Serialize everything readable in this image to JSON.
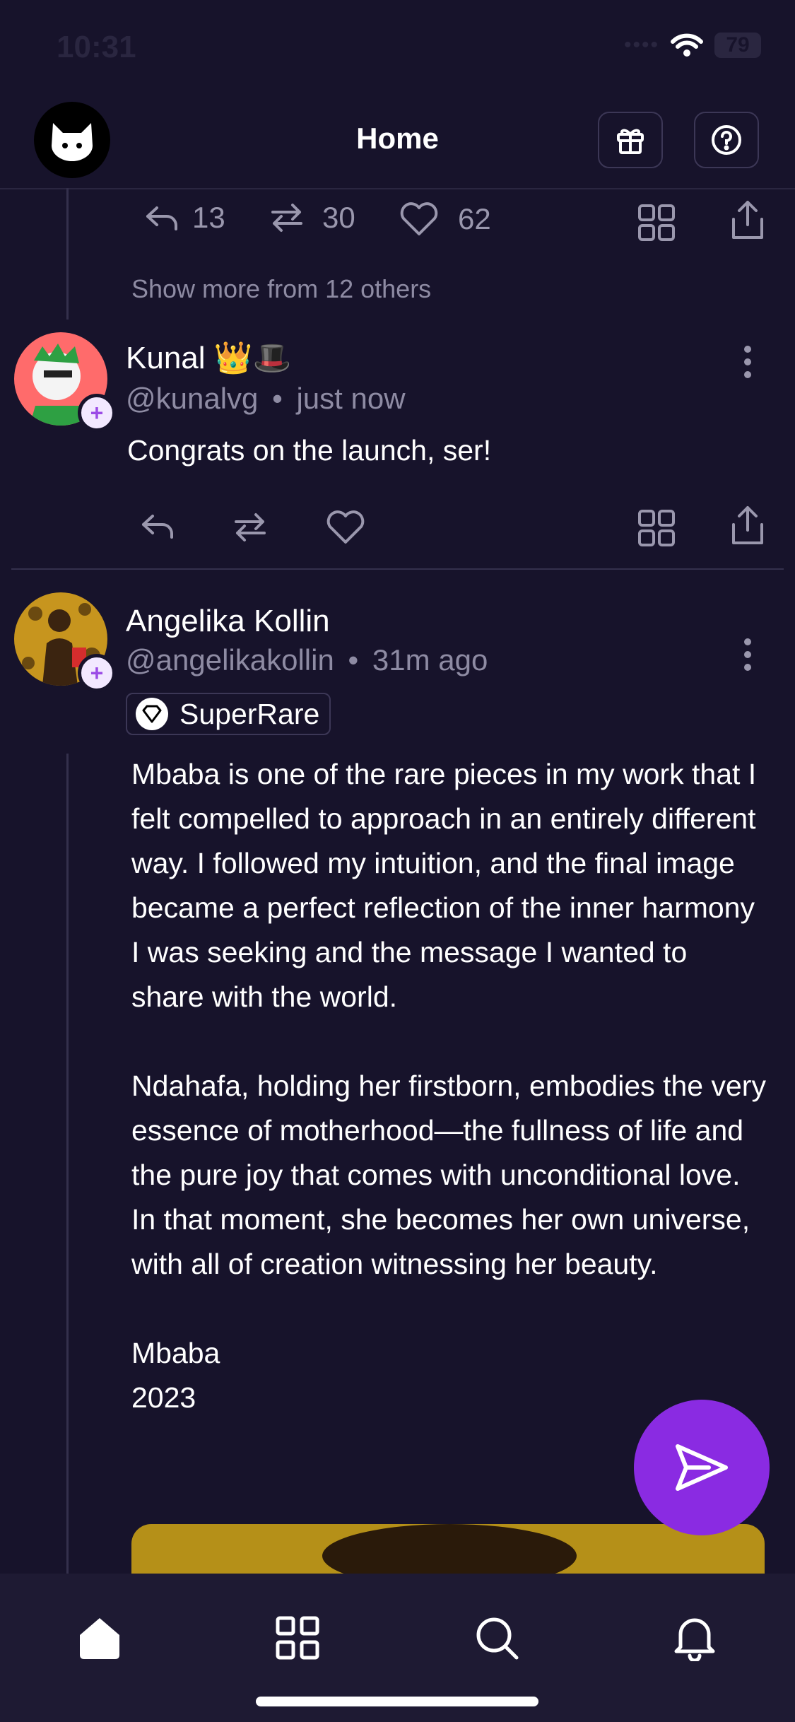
{
  "status_bar": {
    "time": "10:31",
    "battery": "79"
  },
  "header": {
    "title": "Home",
    "logo_icon": "cat-logo-icon",
    "gift_icon": "gift-icon",
    "help_icon": "help-circle-icon"
  },
  "prev_post": {
    "replies": "13",
    "recasts": "30",
    "likes": "62",
    "show_more": "Show more from 12 others"
  },
  "post_kunal": {
    "name": "Kunal 👑🎩",
    "handle": "@kunalvg",
    "time": "just now",
    "text": "Congrats on the launch, ser!"
  },
  "post_angelika": {
    "name": "Angelika Kollin",
    "handle": "@angelikakollin",
    "time": "31m ago",
    "channel": "SuperRare",
    "text": "Mbaba is one of the rare pieces in my work that I felt compelled to approach in an entirely different way. I followed my intuition, and the final image became a perfect reflection of the inner harmony I was seeking and the message I wanted to share with the world.\n\nNdahafa, holding her firstborn, embodies the very essence of motherhood—the fullness of life and the pure joy that comes with unconditional love. In that moment, she becomes her own universe, with all of creation witnessing her beauty.\n\nMbaba\n2023"
  },
  "separator": "•",
  "plus": "+",
  "tabs": [
    "home-icon",
    "grid-icon",
    "search-icon",
    "bell-icon"
  ],
  "colors": {
    "background": "#17132b",
    "accent": "#8a2be2",
    "muted": "#8e8ba3"
  }
}
